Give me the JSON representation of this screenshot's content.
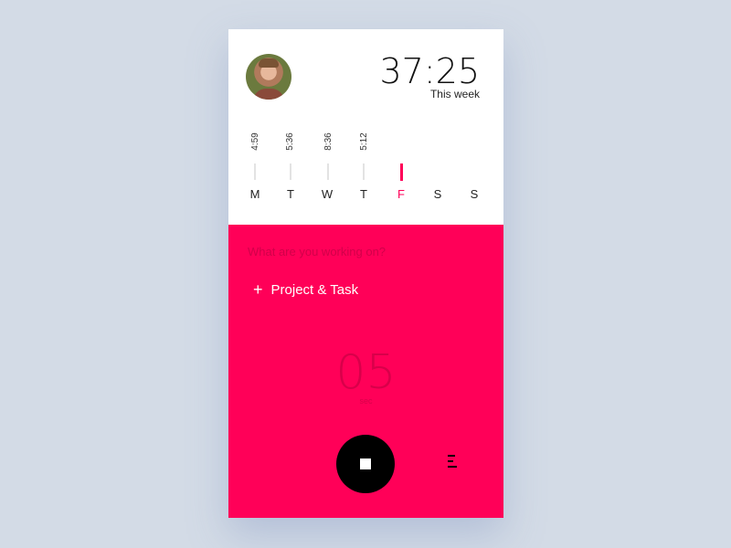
{
  "header": {
    "total_time": "37:25",
    "total_label": "This week"
  },
  "days": [
    {
      "letter": "M",
      "value": "4:59",
      "active": false
    },
    {
      "letter": "T",
      "value": "5:36",
      "active": false
    },
    {
      "letter": "W",
      "value": "8:36",
      "active": false
    },
    {
      "letter": "T",
      "value": "5:12",
      "active": false
    },
    {
      "letter": "F",
      "value": "",
      "active": true
    },
    {
      "letter": "S",
      "value": "",
      "active": false
    },
    {
      "letter": "S",
      "value": "",
      "active": false
    }
  ],
  "tracker": {
    "prompt": "What are you working on?",
    "add_project_label": "Project & Task",
    "timer_value": "05",
    "timer_unit": "sec"
  },
  "colors": {
    "accent": "#ff0058",
    "background": "#d3dbe6"
  },
  "icons": {
    "add": "plus-icon",
    "stop": "stop-icon",
    "menu": "menu-icon"
  }
}
